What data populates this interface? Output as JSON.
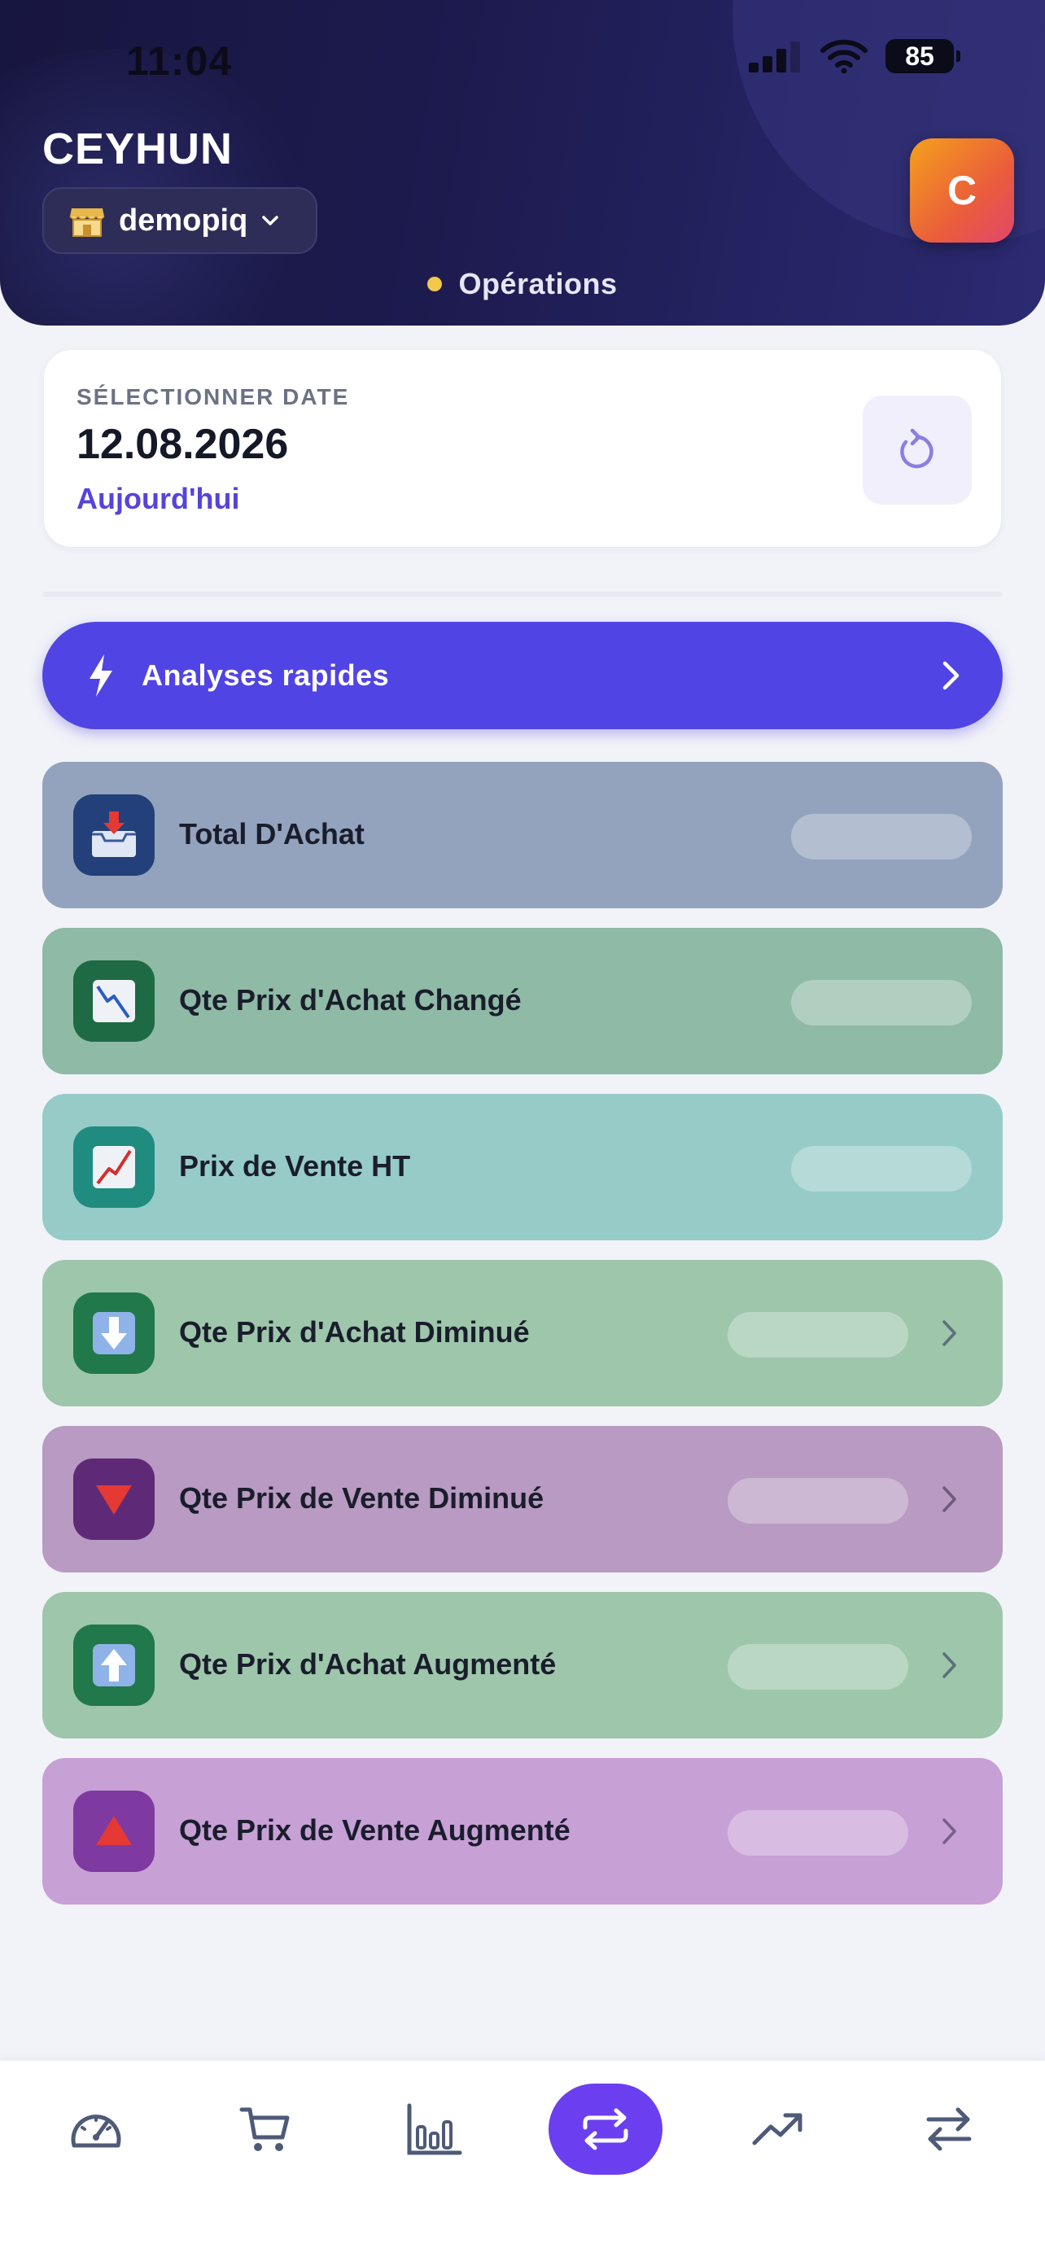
{
  "status_bar": {
    "time": "11:04",
    "battery": "85"
  },
  "header": {
    "user_name": "CEYHUN",
    "store": "demopiq",
    "avatar_initial": "C",
    "section": "Opérations"
  },
  "date_card": {
    "label": "SÉLECTIONNER DATE",
    "date": "12.08.2026",
    "today": "Aujourd'hui"
  },
  "quick_analyses": {
    "label": "Analyses rapides"
  },
  "metrics": [
    {
      "label": "Total D'Achat",
      "icon": "inbox-tray-icon",
      "color": "#93a3bd",
      "icon_bg": "#23407a",
      "has_chevron": false
    },
    {
      "label": "Qte Prix d'Achat Changé",
      "icon": "chart-decreasing-icon",
      "color": "#8fbaa5",
      "icon_bg": "#1e6a45",
      "has_chevron": false
    },
    {
      "label": "Prix de Vente HT",
      "icon": "chart-increasing-icon",
      "color": "#96cbc8",
      "icon_bg": "#1f8c7f",
      "has_chevron": false
    },
    {
      "label": "Qte Prix d'Achat Diminué",
      "icon": "down-arrow-icon",
      "color": "#9dc6ab",
      "icon_bg": "#21784a",
      "has_chevron": true
    },
    {
      "label": "Qte Prix de Vente Diminué",
      "icon": "red-triangle-down-icon",
      "color": "#b89ac2",
      "icon_bg": "#5e2a78",
      "has_chevron": true
    },
    {
      "label": "Qte Prix d'Achat Augmenté",
      "icon": "up-arrow-icon",
      "color": "#9dc6ab",
      "icon_bg": "#21784a",
      "has_chevron": true
    },
    {
      "label": "Qte Prix de Vente Augmenté",
      "icon": "red-triangle-up-icon",
      "color": "#c7a0d6",
      "icon_bg": "#7e3aa0",
      "has_chevron": true
    }
  ],
  "bottom_nav": [
    {
      "icon": "speedometer-icon",
      "active": false
    },
    {
      "icon": "cart-icon",
      "active": false
    },
    {
      "icon": "bar-chart-icon",
      "active": false
    },
    {
      "icon": "repeat-icon",
      "active": true
    },
    {
      "icon": "trending-up-icon",
      "active": false
    },
    {
      "icon": "transfer-arrows-icon",
      "active": false
    }
  ],
  "colors": {
    "accent": "#5044e4",
    "nav_active": "#6b3ff0",
    "header_bg": "#1d1b4f"
  }
}
